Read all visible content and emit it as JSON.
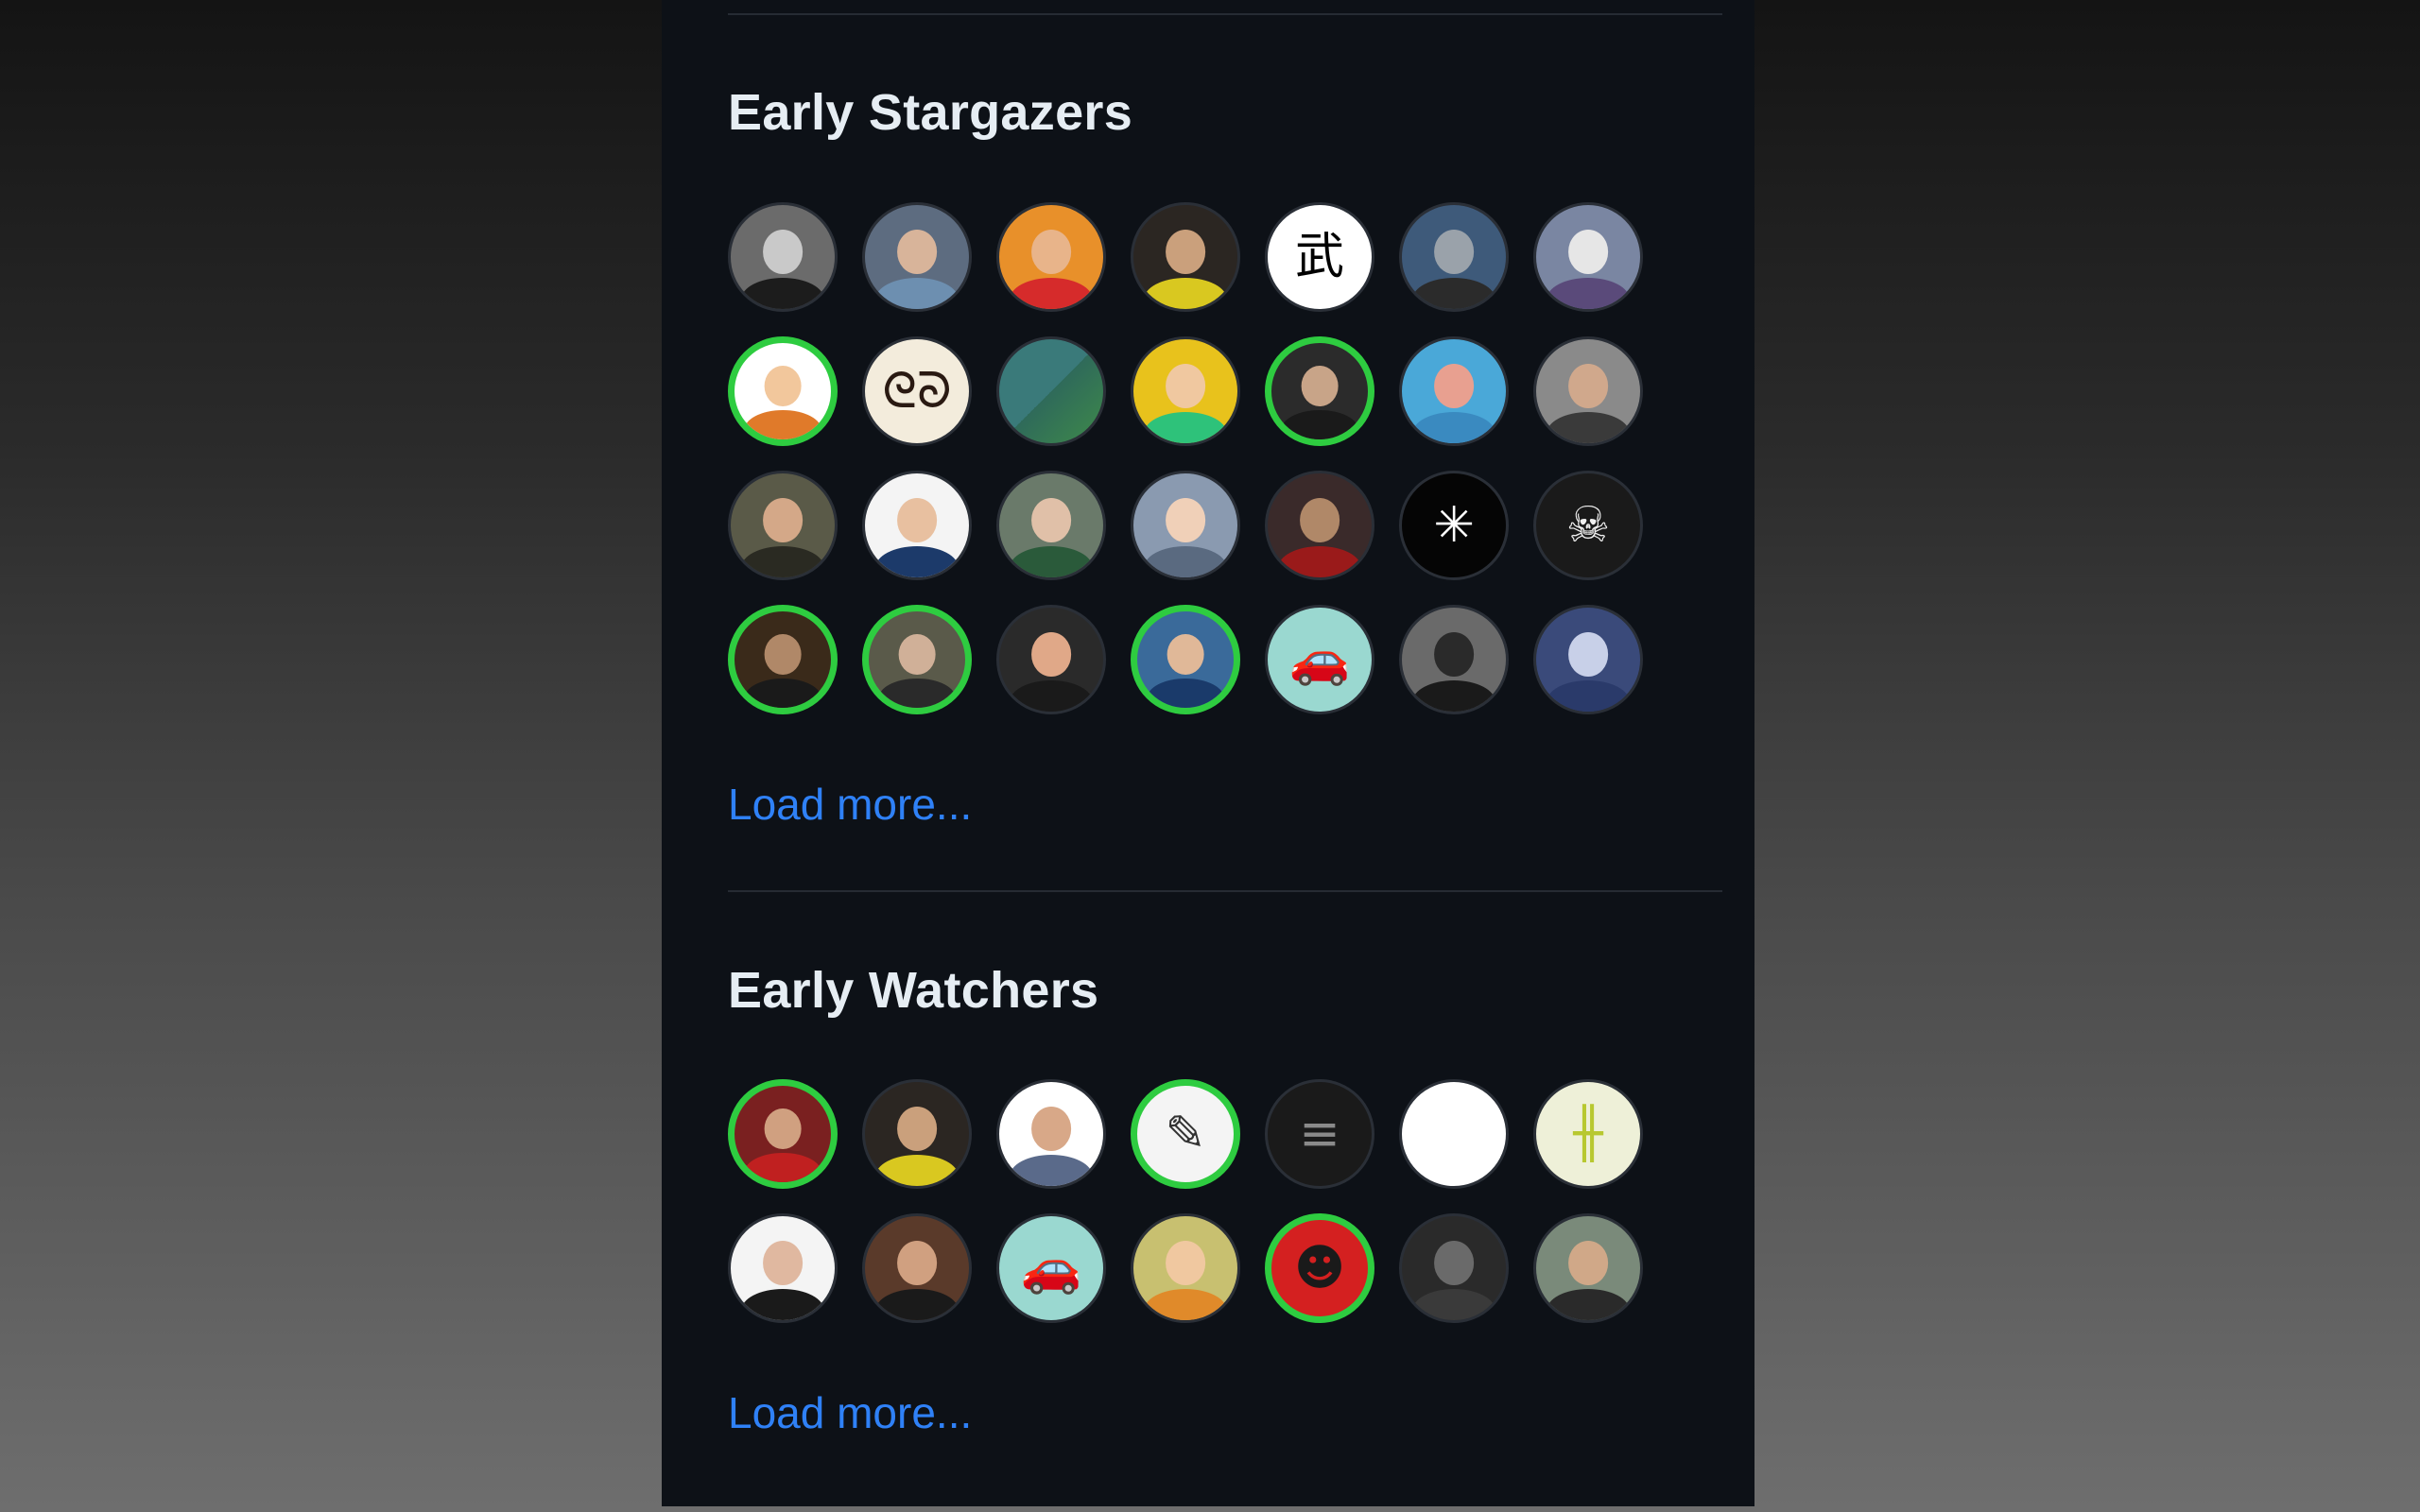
{
  "stargazers": {
    "title": "Early Stargazers",
    "load_more": "Load more...",
    "avatars": [
      {
        "sponsor": false,
        "bg": "#6b6b6b",
        "skin": "#c9c9c9",
        "shirt": "#1c1c1c",
        "icon": "user-avatar-icon"
      },
      {
        "sponsor": false,
        "bg": "#5d6c80",
        "skin": "#d8b49a",
        "shirt": "#6d8fb0",
        "icon": "user-avatar-icon"
      },
      {
        "sponsor": false,
        "bg": "#e8902a",
        "skin": "#e8b48a",
        "shirt": "#d62b2b",
        "icon": "user-avatar-icon"
      },
      {
        "sponsor": false,
        "bg": "#2b2622",
        "skin": "#caa07c",
        "shirt": "#d9c820",
        "icon": "user-avatar-icon"
      },
      {
        "sponsor": false,
        "bg": "#ffffff",
        "glyph": "武",
        "glyphColor": "#000000",
        "icon": "kanji-avatar-icon"
      },
      {
        "sponsor": false,
        "bg": "#3e5a7a",
        "skin": "#9aa2aa",
        "shirt": "#2b2b2b",
        "icon": "user-avatar-icon"
      },
      {
        "sponsor": false,
        "bg": "#7a86a2",
        "skin": "#e6e6e6",
        "shirt": "#5a4a7a",
        "icon": "user-avatar-icon"
      },
      {
        "sponsor": true,
        "bg": "#ffffff",
        "skin": "#f2c79c",
        "shirt": "#e07a2a",
        "icon": "cartoon-avatar-icon"
      },
      {
        "sponsor": false,
        "bg": "#f3ecdc",
        "glyph": "ᘓᘐ",
        "glyphColor": "#2a1a12",
        "icon": "scribble-avatar-icon"
      },
      {
        "sponsor": false,
        "bg": "linear-gradient(135deg,#3a7a7a 0%,#3a7a7a 50%,#2f6a5a 50%,#3e8a4a 100%)",
        "icon": "identicon-avatar-icon"
      },
      {
        "sponsor": false,
        "bg": "#e8c21c",
        "skin": "#f0c8a0",
        "shirt": "#2ec27a",
        "icon": "user-avatar-icon"
      },
      {
        "sponsor": true,
        "bg": "#2b2b2b",
        "skin": "#c8a488",
        "shirt": "#1a1a1a",
        "icon": "user-avatar-icon"
      },
      {
        "sponsor": false,
        "bg": "#4aa8d8",
        "skin": "#e8a090",
        "shirt": "#3a8ac0",
        "icon": "user-avatar-icon"
      },
      {
        "sponsor": false,
        "bg": "#8a8a8a",
        "skin": "#d0a88c",
        "shirt": "#3a3a3a",
        "icon": "user-avatar-icon"
      },
      {
        "sponsor": false,
        "bg": "#5a5a48",
        "skin": "#d4a888",
        "shirt": "#2a2a22",
        "icon": "user-avatar-icon"
      },
      {
        "sponsor": false,
        "bg": "#f4f4f4",
        "skin": "#e8c0a0",
        "shirt": "#1c3a6a",
        "icon": "user-avatar-icon"
      },
      {
        "sponsor": false,
        "bg": "#6a7a6a",
        "skin": "#e0c0a8",
        "shirt": "#2a5a3a",
        "icon": "user-avatar-icon"
      },
      {
        "sponsor": false,
        "bg": "#8a9ab0",
        "skin": "#f0d0b8",
        "shirt": "#5a6a80",
        "icon": "user-avatar-icon"
      },
      {
        "sponsor": false,
        "bg": "#3a2a2a",
        "skin": "#b08868",
        "shirt": "#9a1a1a",
        "icon": "user-avatar-icon"
      },
      {
        "sponsor": false,
        "bg": "#050505",
        "glyph": "✳",
        "glyphColor": "#ffffff",
        "icon": "starburst-avatar-icon"
      },
      {
        "sponsor": false,
        "bg": "#1a1a1a",
        "glyph": "☠",
        "glyphColor": "#f0f0f0",
        "icon": "skull-avatar-icon"
      },
      {
        "sponsor": true,
        "bg": "#3a2a1a",
        "skin": "#b08868",
        "shirt": "#1a1a1a",
        "icon": "user-avatar-icon"
      },
      {
        "sponsor": true,
        "bg": "#5a5a4a",
        "skin": "#d0b098",
        "shirt": "#2a2a2a",
        "icon": "user-avatar-icon"
      },
      {
        "sponsor": false,
        "bg": "#2a2a2a",
        "skin": "#e0a888",
        "shirt": "#1a1a1a",
        "icon": "user-avatar-icon"
      },
      {
        "sponsor": true,
        "bg": "#3a6a9a",
        "skin": "#e0b898",
        "shirt": "#1a3a6a",
        "icon": "user-avatar-icon"
      },
      {
        "sponsor": false,
        "bg": "#9ad8d0",
        "glyph": "🚗",
        "glyphColor": "#d42020",
        "icon": "red-car-avatar-icon"
      },
      {
        "sponsor": false,
        "bg": "#6a6a6a",
        "skin": "#2a2a2a",
        "shirt": "#1a1a1a",
        "icon": "user-avatar-icon"
      },
      {
        "sponsor": false,
        "bg": "#3a4a7a",
        "skin": "#c8d0e8",
        "shirt": "#2a3a6a",
        "icon": "user-avatar-icon"
      }
    ]
  },
  "watchers": {
    "title": "Early Watchers",
    "load_more": "Load more...",
    "avatars": [
      {
        "sponsor": true,
        "bg": "#7a2020",
        "skin": "#d0a080",
        "shirt": "#c02020",
        "icon": "user-avatar-icon"
      },
      {
        "sponsor": false,
        "bg": "#2b2622",
        "skin": "#caa07c",
        "shirt": "#d9c820",
        "icon": "user-avatar-icon"
      },
      {
        "sponsor": false,
        "bg": "#ffffff",
        "skin": "#d8a888",
        "shirt": "#5a6a8a",
        "icon": "user-avatar-icon"
      },
      {
        "sponsor": true,
        "bg": "#f4f4f4",
        "glyph": "✎",
        "glyphColor": "#333333",
        "icon": "sketch-avatar-icon"
      },
      {
        "sponsor": false,
        "bg": "#1a1a1a",
        "glyph": "≡",
        "glyphColor": "#8a8a8a",
        "icon": "code-avatar-icon"
      },
      {
        "sponsor": false,
        "bg": "#ffffff",
        "icon": "blank-avatar-icon"
      },
      {
        "sponsor": false,
        "bg": "#eef0d8",
        "glyph": "╫",
        "glyphColor": "#b8c830",
        "icon": "identicon-avatar-icon"
      },
      {
        "sponsor": false,
        "bg": "#f4f4f4",
        "skin": "#e0b8a0",
        "shirt": "#1a1a1a",
        "icon": "user-avatar-icon"
      },
      {
        "sponsor": false,
        "bg": "#5a3a2a",
        "skin": "#d0a080",
        "shirt": "#1a1a1a",
        "icon": "user-avatar-icon"
      },
      {
        "sponsor": false,
        "bg": "#9ad8d0",
        "glyph": "🚗",
        "glyphColor": "#d42020",
        "icon": "red-car-avatar-icon"
      },
      {
        "sponsor": false,
        "bg": "#c8c070",
        "skin": "#f0c8a0",
        "shirt": "#e08a2a",
        "icon": "user-avatar-icon"
      },
      {
        "sponsor": true,
        "bg": "#d42020",
        "glyph": "☻",
        "glyphColor": "#1a1a1a",
        "icon": "red-creature-avatar-icon"
      },
      {
        "sponsor": false,
        "bg": "#2a2a2a",
        "skin": "#6a6a6a",
        "shirt": "#3a3a3a",
        "icon": "user-avatar-icon"
      },
      {
        "sponsor": false,
        "bg": "#7a8a7a",
        "skin": "#d0a888",
        "shirt": "#2a2a2a",
        "icon": "user-avatar-icon"
      }
    ]
  }
}
